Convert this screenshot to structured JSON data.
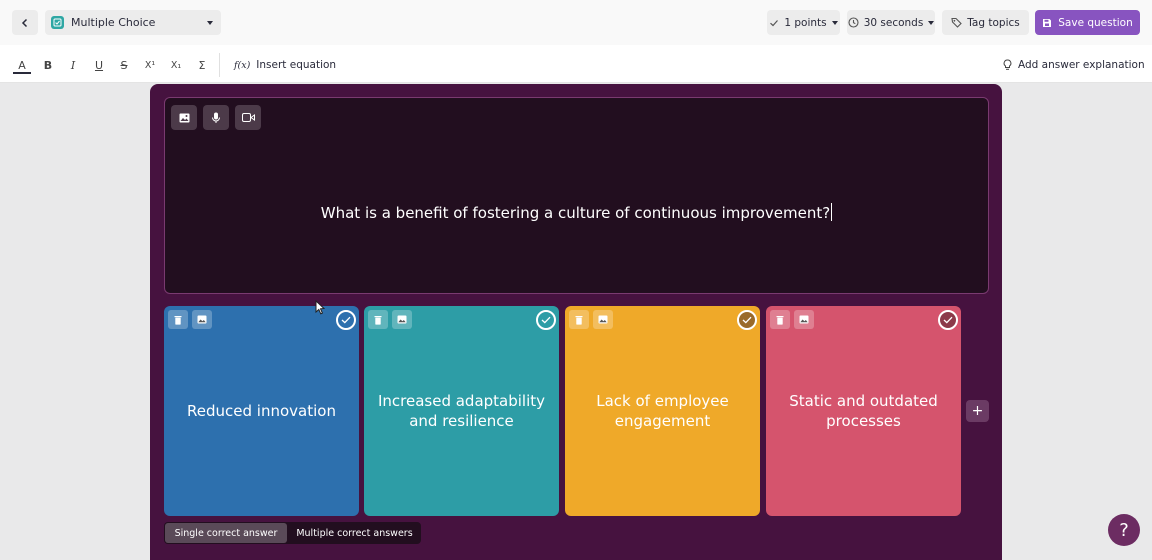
{
  "header": {
    "question_type": "Multiple Choice",
    "points": "1 points",
    "time": "30 seconds",
    "tag_topics": "Tag topics",
    "save": "Save question"
  },
  "toolbar": {
    "insert_equation": "Insert equation",
    "equation_icon": "f(x)",
    "add_explanation": "Add answer explanation",
    "buttons": [
      "A",
      "B",
      "I",
      "U",
      "S",
      "X¹",
      "X₁",
      "Σ"
    ]
  },
  "question": {
    "text": "What is a benefit of fostering a culture of continuous improvement?"
  },
  "options": [
    {
      "text": "Reduced innovation",
      "color": "#2d70ae",
      "selected": false
    },
    {
      "text": "Increased adaptability and resilience",
      "color": "#2d9da6",
      "selected": false
    },
    {
      "text": "Lack of employee engagement",
      "color": "#efa929",
      "selected": false
    },
    {
      "text": "Static and outdated processes",
      "color": "#d5546d",
      "selected": false
    }
  ],
  "add_option": "+",
  "answer_mode": {
    "single": "Single correct answer",
    "multiple": "Multiple correct answers",
    "active": "single"
  },
  "help": "?",
  "colors": {
    "accent": "#8854c0",
    "editor_bg": "#46123f",
    "question_bg": "#220e1f"
  }
}
